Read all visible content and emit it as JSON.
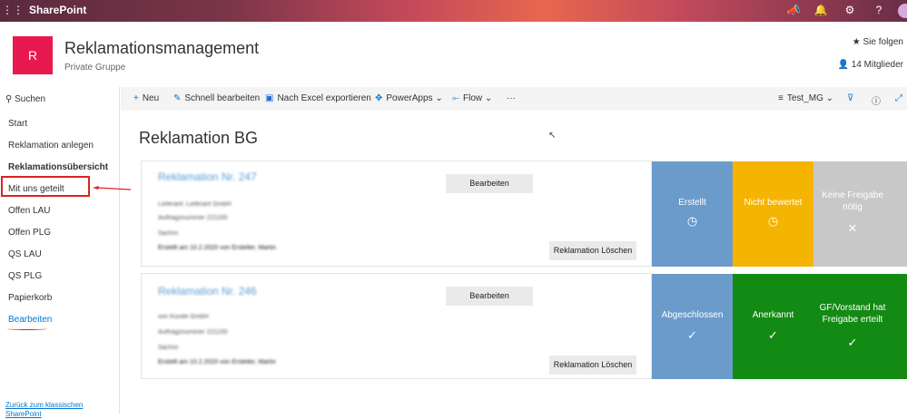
{
  "suite": {
    "brand": "SharePoint"
  },
  "site": {
    "logo_letter": "R",
    "title": "Reklamationsmanagement",
    "subtitle": "Private Gruppe",
    "follow": "Sie folgen",
    "members": "14 Mitglieder"
  },
  "nav": {
    "search": "Suchen",
    "items": [
      "Start",
      "Reklamation anlegen",
      "Reklamationsübersicht",
      "Mit uns geteilt",
      "Offen LAU",
      "Offen PLG",
      "QS LAU",
      "QS PLG",
      "Papierkorb",
      "Bearbeiten"
    ],
    "classic_link": "Zurück zum klassischen SharePoint"
  },
  "commands": {
    "new": "Neu",
    "quick_edit": "Schnell bearbeiten",
    "export": "Nach Excel exportieren",
    "powerapps": "PowerApps",
    "flow": "Flow",
    "more": "···",
    "view": "Test_MG"
  },
  "main": {
    "title": "Reklamation BG"
  },
  "cards": [
    {
      "title": "Reklamation Nr. 247",
      "lines": [
        "Lieferant: Lieferant GmbH",
        "Auftragsnummer 221100",
        "Sachnr.",
        "Erstellt am 10.2.2020 von Ersteller, Martin"
      ],
      "edit_button": "Bearbeiten",
      "delete_button": "Reklamation Löschen",
      "tiles": [
        {
          "label": "Erstellt",
          "icon": "clock-icon",
          "symbol": "🕓",
          "color": "#6b9bcb"
        },
        {
          "label": "Nicht bewertet",
          "icon": "clock-icon",
          "symbol": "🕓",
          "color": "#f5b400"
        },
        {
          "label": "Keine Freigabe nötig",
          "icon": "close-icon",
          "symbol": "✕",
          "color": "#c8c8c8"
        }
      ]
    },
    {
      "title": "Reklamation Nr. 246",
      "lines": [
        "von Kunde GmbH",
        "Auftragsnummer 221100",
        "Sachnr.",
        "Erstellt am 10.2.2020 von Ersteller, Martin"
      ],
      "edit_button": "Bearbeiten",
      "delete_button": "Reklamation Löschen",
      "tiles": [
        {
          "label": "Abgeschlossen",
          "icon": "check-icon",
          "symbol": "✓",
          "color": "#6b9bcb"
        },
        {
          "label": "Anerkannt",
          "icon": "check-icon",
          "symbol": "✓",
          "color": "#138a13"
        },
        {
          "label": "GF/Vorstand hat Freigabe erteilt",
          "icon": "check-icon",
          "symbol": "✓",
          "color": "#138a13"
        }
      ]
    }
  ]
}
